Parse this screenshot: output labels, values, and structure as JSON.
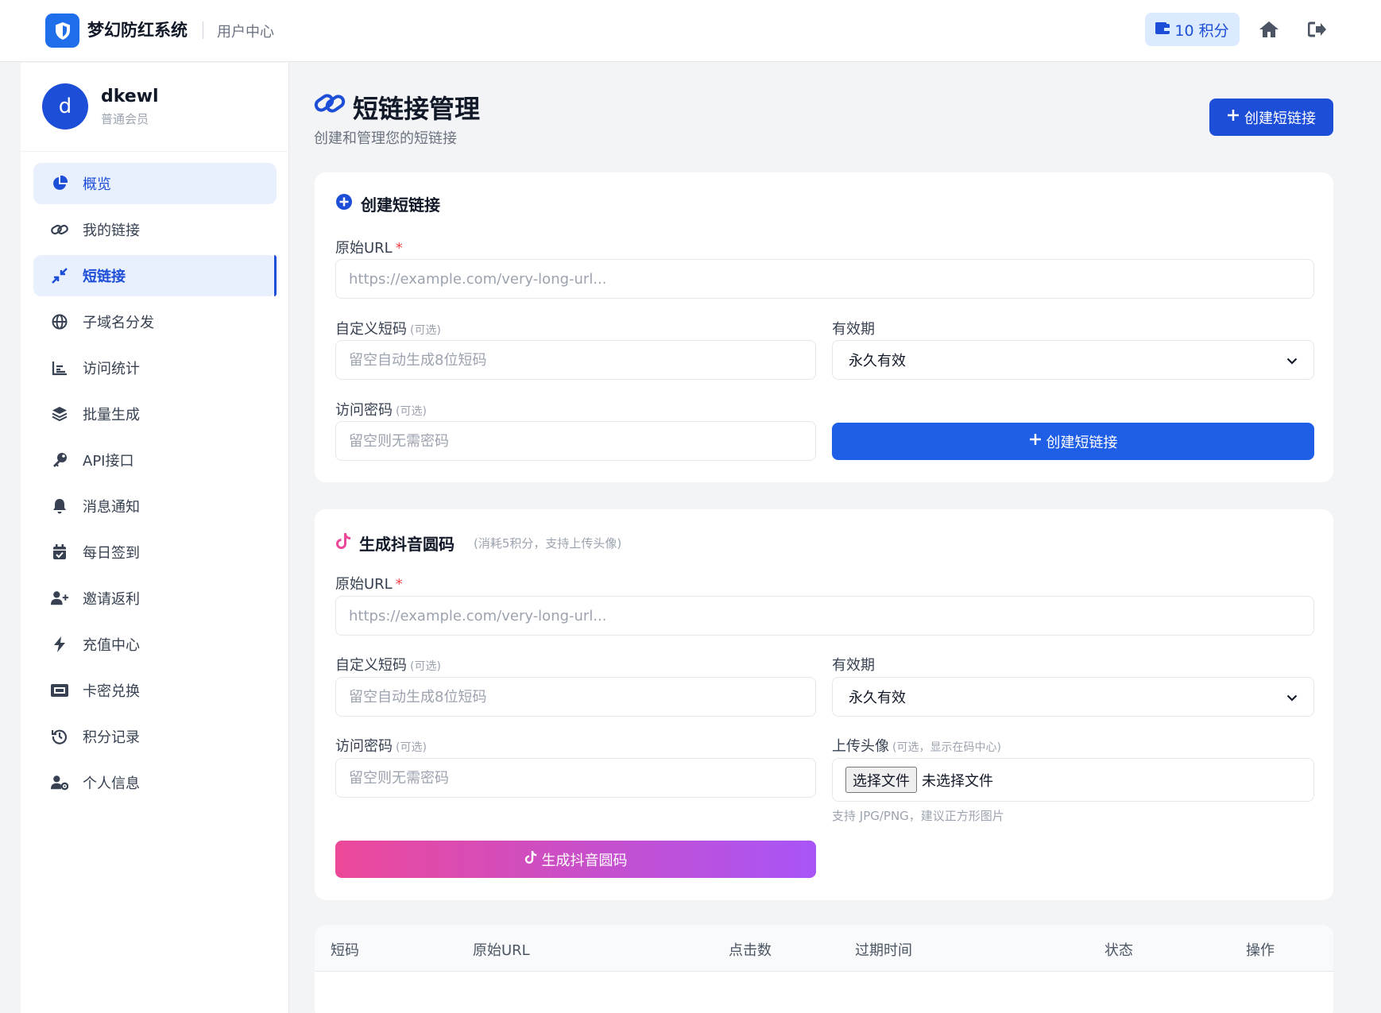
{
  "topbar": {
    "app_name": "梦幻防红系统",
    "section": "用户中心",
    "points": "10 积分"
  },
  "user": {
    "avatar_letter": "d",
    "name": "dkewl",
    "level": "普通会员"
  },
  "nav": {
    "items": [
      {
        "label": "概览",
        "icon": "pie-chart-icon"
      },
      {
        "label": "我的链接",
        "icon": "link-icon"
      },
      {
        "label": "短链接",
        "icon": "compress-icon"
      },
      {
        "label": "子域名分发",
        "icon": "globe-icon"
      },
      {
        "label": "访问统计",
        "icon": "bar-chart-icon"
      },
      {
        "label": "批量生成",
        "icon": "layers-icon"
      },
      {
        "label": "API接口",
        "icon": "key-icon"
      },
      {
        "label": "消息通知",
        "icon": "bell-icon"
      },
      {
        "label": "每日签到",
        "icon": "calendar-check-icon"
      },
      {
        "label": "邀请返利",
        "icon": "user-plus-icon"
      },
      {
        "label": "充值中心",
        "icon": "bolt-icon"
      },
      {
        "label": "卡密兑换",
        "icon": "ticket-icon"
      },
      {
        "label": "积分记录",
        "icon": "history-icon"
      },
      {
        "label": "个人信息",
        "icon": "user-gear-icon"
      }
    ]
  },
  "page": {
    "title": "短链接管理",
    "subtitle": "创建和管理您的短链接",
    "create_button": "创建短链接"
  },
  "create_form": {
    "title": "创建短链接",
    "url_label": "原始URL",
    "required_mark": "*",
    "url_placeholder": "https://example.com/very-long-url...",
    "code_label": "自定义短码",
    "optional": "(可选)",
    "code_placeholder": "留空自动生成8位短码",
    "expire_label": "有效期",
    "expire_value": "永久有效",
    "password_label": "访问密码",
    "password_placeholder": "留空则无需密码",
    "submit": "创建短链接"
  },
  "douyin_form": {
    "title": "生成抖音圆码",
    "hint": "(消耗5积分，支持上传头像)",
    "url_label": "原始URL",
    "required_mark": "*",
    "url_placeholder": "https://example.com/very-long-url...",
    "code_label": "自定义短码",
    "optional": "(可选)",
    "code_placeholder": "留空自动生成8位短码",
    "expire_label": "有效期",
    "expire_value": "永久有效",
    "password_label": "访问密码",
    "password_placeholder": "留空则无需密码",
    "avatar_label": "上传头像",
    "avatar_hint": "(可选，显示在码中心)",
    "file_button": "选择文件",
    "file_status": "未选择文件",
    "file_note": "支持 JPG/PNG，建议正方形图片",
    "submit": "生成抖音圆码"
  },
  "table": {
    "columns": [
      "短码",
      "原始URL",
      "点击数",
      "过期时间",
      "状态",
      "操作"
    ]
  },
  "colors": {
    "primary": "#1d4ed8",
    "gradient_start": "#ec4899",
    "gradient_end": "#a855f7"
  }
}
